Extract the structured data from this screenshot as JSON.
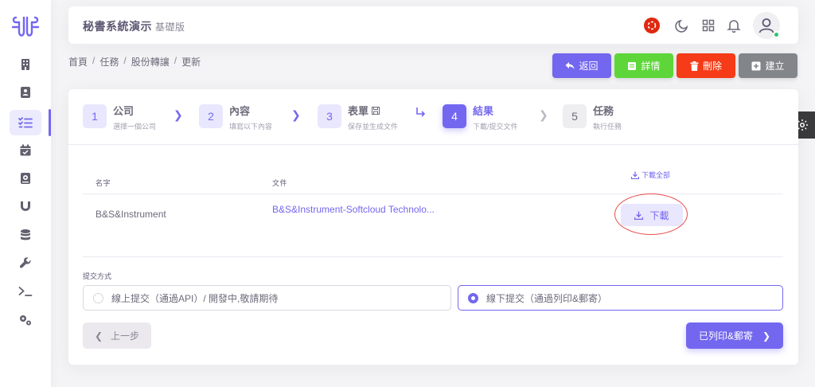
{
  "app": {
    "title": "秘書系統演示",
    "edition": "基礎版"
  },
  "colors": {
    "primary": "#7367f0",
    "success": "#5ed63a",
    "danger": "#f53b17",
    "secondary": "#82868b",
    "annotation": "#e84d4d"
  },
  "sidebar": {
    "items": [
      {
        "icon": "building-icon",
        "active": false
      },
      {
        "icon": "contact-book-icon",
        "active": false
      },
      {
        "icon": "task-list-icon",
        "active": true
      },
      {
        "icon": "calendar-check-icon",
        "active": false
      },
      {
        "icon": "address-book-icon",
        "active": false
      },
      {
        "icon": "magnet-icon",
        "active": false
      },
      {
        "icon": "database-icon",
        "active": false
      },
      {
        "icon": "wrench-icon",
        "active": false
      },
      {
        "icon": "terminal-icon",
        "active": false
      },
      {
        "icon": "cogs-icon",
        "active": false
      }
    ]
  },
  "topbar": {
    "icons": [
      "hong-kong-flag-icon",
      "moon-icon",
      "grid-icon",
      "bell-icon",
      "user-avatar-icon"
    ]
  },
  "breadcrumb": [
    "首頁",
    "任務",
    "股份轉讓",
    "更新"
  ],
  "actions": {
    "back": "返回",
    "detail": "詳情",
    "delete": "刪除",
    "create": "建立"
  },
  "steps": [
    {
      "num": "1",
      "title": "公司",
      "sub": "選擇一個公司"
    },
    {
      "num": "2",
      "title": "內容",
      "sub": "填寫以下內容"
    },
    {
      "num": "3",
      "title": "表單",
      "sub": "保存並生成文件"
    },
    {
      "num": "4",
      "title": "結果",
      "sub": "下載/提交文件"
    },
    {
      "num": "5",
      "title": "任務",
      "sub": "執行任務"
    }
  ],
  "table": {
    "headers": {
      "name": "名字",
      "file": "文件"
    },
    "download_all": "下載全部",
    "rows": [
      {
        "name": "B&S&Instrument",
        "file": "B&S&Instrument-Softcloud Technolo...",
        "action": "下載"
      }
    ]
  },
  "submit": {
    "label": "提交方式",
    "online": "線上提交（通過API）/ 開發中,敬請期待",
    "offline": "線下提交（通過列印&郵寄）",
    "selected": "offline"
  },
  "nav": {
    "prev": "上一步",
    "next": "已列印&郵寄"
  }
}
